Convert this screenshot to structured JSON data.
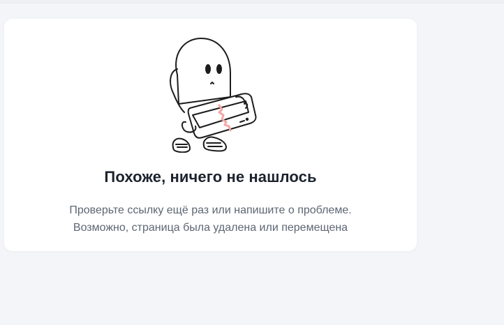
{
  "error": {
    "title": "Похоже, ничего не нашлось",
    "description_line1": "Проверьте ссылку ещё раз или напишите о проблеме.",
    "description_line2": "Возможно, страница была удалена или перемещена"
  },
  "illustration": {
    "name": "sad-character-with-torn-tablet-icon",
    "accent_color": "#f4a6a6",
    "stroke_color": "#1c1c1c"
  },
  "colors": {
    "background": "#f4f5f8",
    "card": "#ffffff",
    "title": "#1c232e",
    "description": "#5d6673"
  }
}
